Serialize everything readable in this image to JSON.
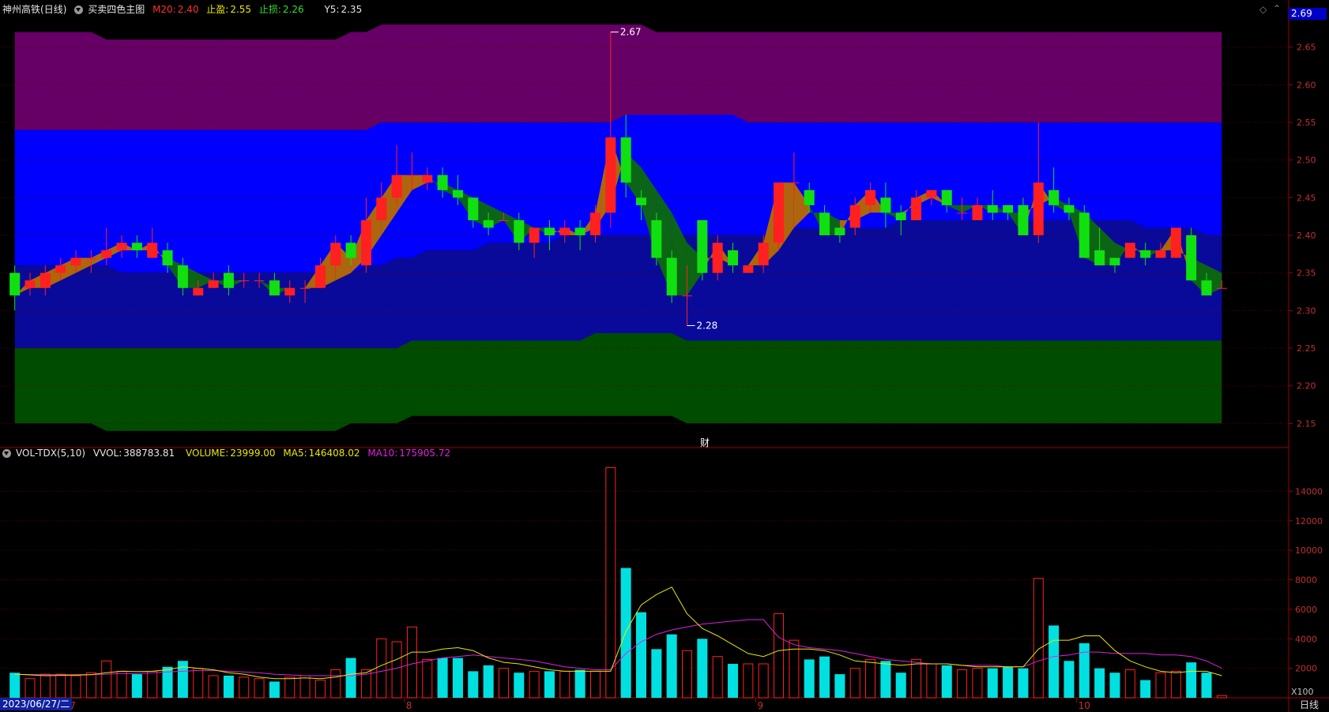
{
  "header": {
    "stock_name": "神州高铁",
    "period": "(日线)",
    "indicator": "买卖四色主图",
    "m20_label": "M20:",
    "m20_value": "2.40",
    "tp_label": "止盈:",
    "tp_value": "2.55",
    "sl_label": "止损:",
    "sl_value": "2.26",
    "y5_label": "Y5:",
    "y5_value": "2.35",
    "current_price_tag": "2.69",
    "diamond_icon": "diamond-icon"
  },
  "vol_header": {
    "indicator": "VOL-TDX(5,10)",
    "vvol_label": "VVOL:",
    "vvol_value": "388783.81",
    "volume_label": "VOLUME:",
    "volume_value": "23999.00",
    "ma5_label": "MA5:",
    "ma5_value": "146408.02",
    "ma10_label": "MA10:",
    "ma10_value": "175905.72"
  },
  "footer": {
    "date": "2023/06/27/二",
    "period_label": "日线",
    "vol_unit": "X100",
    "fin_marker": "财"
  },
  "colors": {
    "up": "#ff2020",
    "down": "#00e0e0",
    "purple": "#660066",
    "blue": "#0000ff",
    "navy": "#0a0a9a",
    "green": "#004c00",
    "ma5": "#e8e800",
    "ma10": "#e020e0"
  },
  "chart_data": [
    {
      "type": "candlestick",
      "y_ticks": [
        "2.65",
        "2.60",
        "2.55",
        "2.50",
        "2.45",
        "2.40",
        "2.35",
        "2.30",
        "2.25",
        "2.20",
        "2.15"
      ],
      "ylim": [
        2.12,
        2.7
      ],
      "x_month_labels": [
        {
          "label": "7",
          "index": 4
        },
        {
          "label": "8",
          "index": 26
        },
        {
          "label": "9",
          "index": 49
        },
        {
          "label": "10",
          "index": 70
        }
      ],
      "annotations": [
        {
          "label": "2.67",
          "index": 39,
          "price": 2.67
        },
        {
          "label": "2.28",
          "index": 44,
          "price": 2.28
        }
      ],
      "candles": [
        [
          2.35,
          2.32,
          2.36,
          2.3
        ],
        [
          2.33,
          2.34,
          2.35,
          2.32
        ],
        [
          2.33,
          2.35,
          2.36,
          2.32
        ],
        [
          2.35,
          2.36,
          2.37,
          2.34
        ],
        [
          2.36,
          2.37,
          2.38,
          2.35
        ],
        [
          2.37,
          2.37,
          2.38,
          2.35
        ],
        [
          2.37,
          2.38,
          2.41,
          2.36
        ],
        [
          2.38,
          2.39,
          2.4,
          2.37
        ],
        [
          2.39,
          2.38,
          2.4,
          2.37
        ],
        [
          2.37,
          2.39,
          2.41,
          2.37
        ],
        [
          2.38,
          2.36,
          2.39,
          2.35
        ],
        [
          2.36,
          2.33,
          2.37,
          2.32
        ],
        [
          2.32,
          2.33,
          2.34,
          2.32
        ],
        [
          2.33,
          2.34,
          2.35,
          2.33
        ],
        [
          2.35,
          2.33,
          2.36,
          2.32
        ],
        [
          2.34,
          2.34,
          2.35,
          2.33
        ],
        [
          2.34,
          2.34,
          2.35,
          2.33
        ],
        [
          2.34,
          2.32,
          2.35,
          2.32
        ],
        [
          2.32,
          2.33,
          2.34,
          2.31
        ],
        [
          2.33,
          2.33,
          2.34,
          2.31
        ],
        [
          2.33,
          2.36,
          2.37,
          2.33
        ],
        [
          2.36,
          2.39,
          2.4,
          2.35
        ],
        [
          2.39,
          2.37,
          2.4,
          2.36
        ],
        [
          2.36,
          2.42,
          2.45,
          2.35
        ],
        [
          2.42,
          2.45,
          2.47,
          2.42
        ],
        [
          2.45,
          2.48,
          2.52,
          2.44
        ],
        [
          2.48,
          2.48,
          2.51,
          2.46
        ],
        [
          2.47,
          2.48,
          2.49,
          2.46
        ],
        [
          2.48,
          2.46,
          2.49,
          2.45
        ],
        [
          2.46,
          2.45,
          2.48,
          2.44
        ],
        [
          2.45,
          2.42,
          2.45,
          2.41
        ],
        [
          2.42,
          2.41,
          2.43,
          2.4
        ],
        [
          2.42,
          2.42,
          2.43,
          2.42
        ],
        [
          2.42,
          2.39,
          2.43,
          2.38
        ],
        [
          2.39,
          2.41,
          2.41,
          2.37
        ],
        [
          2.41,
          2.4,
          2.42,
          2.38
        ],
        [
          2.4,
          2.41,
          2.42,
          2.39
        ],
        [
          2.41,
          2.4,
          2.42,
          2.38
        ],
        [
          2.4,
          2.43,
          2.44,
          2.39
        ],
        [
          2.43,
          2.53,
          2.67,
          2.41
        ],
        [
          2.53,
          2.47,
          2.56,
          2.45
        ],
        [
          2.45,
          2.44,
          2.46,
          2.42
        ],
        [
          2.42,
          2.37,
          2.43,
          2.36
        ],
        [
          2.37,
          2.32,
          2.38,
          2.31
        ],
        [
          2.32,
          2.32,
          2.36,
          2.28
        ],
        [
          2.42,
          2.35,
          2.42,
          2.34
        ],
        [
          2.35,
          2.39,
          2.4,
          2.34
        ],
        [
          2.38,
          2.36,
          2.39,
          2.35
        ],
        [
          2.35,
          2.36,
          2.36,
          2.35
        ],
        [
          2.36,
          2.39,
          2.4,
          2.35
        ],
        [
          2.39,
          2.47,
          2.47,
          2.38
        ],
        [
          2.47,
          2.47,
          2.51,
          2.45
        ],
        [
          2.46,
          2.44,
          2.47,
          2.43
        ],
        [
          2.43,
          2.4,
          2.44,
          2.4
        ],
        [
          2.41,
          2.4,
          2.41,
          2.39
        ],
        [
          2.41,
          2.44,
          2.45,
          2.4
        ],
        [
          2.44,
          2.46,
          2.47,
          2.43
        ],
        [
          2.45,
          2.43,
          2.47,
          2.41
        ],
        [
          2.43,
          2.42,
          2.44,
          2.4
        ],
        [
          2.42,
          2.45,
          2.46,
          2.42
        ],
        [
          2.45,
          2.46,
          2.46,
          2.44
        ],
        [
          2.46,
          2.44,
          2.46,
          2.43
        ],
        [
          2.43,
          2.43,
          2.45,
          2.42
        ],
        [
          2.42,
          2.44,
          2.45,
          2.42
        ],
        [
          2.44,
          2.43,
          2.46,
          2.42
        ],
        [
          2.44,
          2.43,
          2.44,
          2.42
        ],
        [
          2.44,
          2.4,
          2.45,
          2.4
        ],
        [
          2.4,
          2.47,
          2.55,
          2.39
        ],
        [
          2.46,
          2.44,
          2.49,
          2.43
        ],
        [
          2.44,
          2.43,
          2.45,
          2.42
        ],
        [
          2.43,
          2.37,
          2.44,
          2.37
        ],
        [
          2.38,
          2.36,
          2.41,
          2.36
        ],
        [
          2.37,
          2.36,
          2.37,
          2.35
        ],
        [
          2.37,
          2.39,
          2.39,
          2.37
        ],
        [
          2.38,
          2.37,
          2.39,
          2.36
        ],
        [
          2.37,
          2.38,
          2.39,
          2.37
        ],
        [
          2.37,
          2.41,
          2.41,
          2.37
        ],
        [
          2.4,
          2.34,
          2.41,
          2.34
        ],
        [
          2.34,
          2.32,
          2.35,
          2.32
        ],
        [
          2.33,
          2.33,
          2.34,
          2.33
        ]
      ],
      "ma_line": [
        2.32,
        2.33,
        2.33,
        2.34,
        2.35,
        2.36,
        2.37,
        2.38,
        2.38,
        2.38,
        2.37,
        2.36,
        2.35,
        2.34,
        2.34,
        2.34,
        2.34,
        2.33,
        2.33,
        2.33,
        2.33,
        2.34,
        2.35,
        2.37,
        2.4,
        2.43,
        2.46,
        2.47,
        2.47,
        2.46,
        2.45,
        2.44,
        2.43,
        2.42,
        2.41,
        2.41,
        2.4,
        2.4,
        2.41,
        2.44,
        2.51,
        2.49,
        2.46,
        2.43,
        2.39,
        2.37,
        2.37,
        2.36,
        2.36,
        2.36,
        2.38,
        2.41,
        2.43,
        2.43,
        2.42,
        2.42,
        2.43,
        2.43,
        2.43,
        2.44,
        2.45,
        2.44,
        2.44,
        2.44,
        2.44,
        2.43,
        2.43,
        2.44,
        2.45,
        2.44,
        2.43,
        2.41,
        2.39,
        2.38,
        2.38,
        2.38,
        2.38,
        2.37,
        2.36,
        2.35
      ],
      "bands": {
        "top": [
          2.67,
          2.67,
          2.67,
          2.67,
          2.67,
          2.67,
          2.66,
          2.66,
          2.66,
          2.66,
          2.66,
          2.66,
          2.66,
          2.66,
          2.66,
          2.66,
          2.66,
          2.66,
          2.66,
          2.66,
          2.66,
          2.66,
          2.67,
          2.67,
          2.68,
          2.68,
          2.68,
          2.68,
          2.68,
          2.68,
          2.68,
          2.68,
          2.68,
          2.68,
          2.68,
          2.68,
          2.68,
          2.68,
          2.68,
          2.68,
          2.68,
          2.68,
          2.67,
          2.67,
          2.67,
          2.67,
          2.67,
          2.67,
          2.67,
          2.67,
          2.67,
          2.67,
          2.67,
          2.67,
          2.67,
          2.67,
          2.67,
          2.67,
          2.67,
          2.67,
          2.67,
          2.67,
          2.67,
          2.67,
          2.67,
          2.67,
          2.67,
          2.67,
          2.67,
          2.67,
          2.67,
          2.67,
          2.67,
          2.67,
          2.67,
          2.67,
          2.67,
          2.67,
          2.67,
          2.67
        ],
        "upper": [
          2.54,
          2.54,
          2.54,
          2.54,
          2.54,
          2.54,
          2.54,
          2.54,
          2.54,
          2.54,
          2.54,
          2.54,
          2.54,
          2.54,
          2.54,
          2.54,
          2.54,
          2.54,
          2.54,
          2.54,
          2.54,
          2.54,
          2.54,
          2.54,
          2.55,
          2.55,
          2.55,
          2.55,
          2.55,
          2.55,
          2.55,
          2.55,
          2.55,
          2.55,
          2.55,
          2.55,
          2.55,
          2.55,
          2.55,
          2.55,
          2.56,
          2.56,
          2.56,
          2.56,
          2.56,
          2.56,
          2.56,
          2.56,
          2.55,
          2.55,
          2.55,
          2.55,
          2.55,
          2.55,
          2.55,
          2.55,
          2.55,
          2.55,
          2.55,
          2.55,
          2.55,
          2.55,
          2.55,
          2.55,
          2.55,
          2.55,
          2.55,
          2.55,
          2.55,
          2.55,
          2.55,
          2.55,
          2.55,
          2.55,
          2.55,
          2.55,
          2.55,
          2.55,
          2.55,
          2.55
        ],
        "mid": [
          2.36,
          2.36,
          2.36,
          2.36,
          2.36,
          2.36,
          2.36,
          2.35,
          2.35,
          2.35,
          2.35,
          2.35,
          2.35,
          2.35,
          2.35,
          2.35,
          2.35,
          2.35,
          2.35,
          2.35,
          2.35,
          2.35,
          2.35,
          2.36,
          2.36,
          2.37,
          2.37,
          2.38,
          2.38,
          2.38,
          2.38,
          2.39,
          2.39,
          2.39,
          2.39,
          2.39,
          2.4,
          2.4,
          2.4,
          2.4,
          2.4,
          2.4,
          2.4,
          2.4,
          2.4,
          2.4,
          2.4,
          2.4,
          2.4,
          2.4,
          2.4,
          2.41,
          2.41,
          2.41,
          2.41,
          2.41,
          2.41,
          2.41,
          2.42,
          2.42,
          2.42,
          2.42,
          2.42,
          2.42,
          2.42,
          2.42,
          2.42,
          2.42,
          2.42,
          2.42,
          2.42,
          2.42,
          2.42,
          2.42,
          2.41,
          2.41,
          2.41,
          2.41,
          2.4,
          2.4
        ],
        "lower": [
          2.25,
          2.25,
          2.25,
          2.25,
          2.25,
          2.25,
          2.25,
          2.25,
          2.25,
          2.25,
          2.25,
          2.25,
          2.25,
          2.25,
          2.25,
          2.25,
          2.25,
          2.25,
          2.25,
          2.25,
          2.25,
          2.25,
          2.25,
          2.25,
          2.25,
          2.25,
          2.26,
          2.26,
          2.26,
          2.26,
          2.26,
          2.26,
          2.26,
          2.26,
          2.26,
          2.26,
          2.26,
          2.26,
          2.27,
          2.27,
          2.27,
          2.27,
          2.27,
          2.27,
          2.26,
          2.26,
          2.26,
          2.26,
          2.26,
          2.26,
          2.26,
          2.26,
          2.26,
          2.26,
          2.26,
          2.26,
          2.26,
          2.26,
          2.26,
          2.26,
          2.26,
          2.26,
          2.26,
          2.26,
          2.26,
          2.26,
          2.26,
          2.26,
          2.26,
          2.26,
          2.26,
          2.26,
          2.26,
          2.26,
          2.26,
          2.26,
          2.26,
          2.26,
          2.26,
          2.26
        ],
        "bottom": [
          2.15,
          2.15,
          2.15,
          2.15,
          2.15,
          2.15,
          2.14,
          2.14,
          2.14,
          2.14,
          2.14,
          2.14,
          2.14,
          2.14,
          2.14,
          2.14,
          2.14,
          2.14,
          2.14,
          2.14,
          2.14,
          2.14,
          2.15,
          2.15,
          2.15,
          2.15,
          2.16,
          2.16,
          2.16,
          2.16,
          2.16,
          2.16,
          2.16,
          2.16,
          2.16,
          2.16,
          2.16,
          2.16,
          2.16,
          2.16,
          2.16,
          2.16,
          2.16,
          2.16,
          2.15,
          2.15,
          2.15,
          2.15,
          2.15,
          2.15,
          2.15,
          2.15,
          2.15,
          2.15,
          2.15,
          2.15,
          2.15,
          2.15,
          2.15,
          2.15,
          2.15,
          2.15,
          2.15,
          2.15,
          2.15,
          2.15,
          2.15,
          2.15,
          2.15,
          2.15,
          2.15,
          2.15,
          2.15,
          2.15,
          2.15,
          2.15,
          2.15,
          2.15,
          2.15,
          2.15
        ]
      }
    },
    {
      "type": "bar",
      "title": "VOL-TDX(5,10)",
      "y_ticks": [
        "14000",
        "12000",
        "10000",
        "8000",
        "6000",
        "4000",
        "2000"
      ],
      "ylim": [
        0,
        16000
      ],
      "volumes": [
        1700,
        1300,
        1600,
        1600,
        1500,
        1700,
        2500,
        1800,
        1600,
        1800,
        2100,
        2500,
        2000,
        1500,
        1500,
        1400,
        1300,
        1100,
        1400,
        1500,
        1200,
        1900,
        2700,
        1900,
        4000,
        3800,
        4800,
        2600,
        2700,
        2700,
        1800,
        2200,
        2000,
        1700,
        1800,
        1800,
        1800,
        1900,
        1800,
        15600,
        8800,
        5800,
        3300,
        4300,
        3200,
        4000,
        2800,
        2300,
        2300,
        2300,
        5700,
        3900,
        2600,
        2800,
        1600,
        2000,
        2600,
        2500,
        1700,
        2600,
        2300,
        2200,
        1900,
        2000,
        2000,
        2100,
        2000,
        8100,
        4900,
        2500,
        3700,
        2000,
        1700,
        1900,
        1200,
        1700,
        1800,
        2400,
        1700,
        150
      ],
      "ma5": [
        1600,
        1550,
        1500,
        1520,
        1540,
        1560,
        1700,
        1800,
        1780,
        1800,
        1900,
        2100,
        2000,
        1900,
        1700,
        1600,
        1400,
        1300,
        1300,
        1350,
        1300,
        1400,
        1600,
        1700,
        2200,
        2600,
        3100,
        3100,
        3300,
        3400,
        3200,
        2700,
        2400,
        2300,
        2100,
        1900,
        1800,
        1800,
        1800,
        1800,
        4500,
        6300,
        7000,
        7500,
        5700,
        4700,
        4200,
        3600,
        3000,
        2800,
        3200,
        3300,
        3300,
        3200,
        2900,
        2500,
        2400,
        2300,
        2200,
        2300,
        2300,
        2300,
        2200,
        2100,
        2100,
        2100,
        2100,
        3300,
        3900,
        3900,
        4200,
        4200,
        3200,
        2500,
        2100,
        1800,
        1700,
        1800,
        1800,
        1500
      ],
      "ma10": [
        1600,
        1580,
        1560,
        1560,
        1560,
        1580,
        1600,
        1650,
        1650,
        1700,
        1750,
        1800,
        1850,
        1850,
        1800,
        1750,
        1700,
        1600,
        1550,
        1500,
        1500,
        1500,
        1500,
        1600,
        1800,
        2000,
        2300,
        2500,
        2700,
        2800,
        2900,
        2800,
        2700,
        2600,
        2500,
        2300,
        2100,
        2000,
        1900,
        1900,
        3000,
        3800,
        4300,
        4600,
        4800,
        5000,
        5100,
        5200,
        5300,
        5300,
        4100,
        3600,
        3400,
        3300,
        3200,
        3000,
        2800,
        2600,
        2500,
        2400,
        2300,
        2300,
        2200,
        2200,
        2200,
        2100,
        2100,
        2500,
        2800,
        2900,
        3100,
        3100,
        3000,
        3000,
        3000,
        2900,
        2900,
        2800,
        2500,
        2000
      ]
    }
  ]
}
